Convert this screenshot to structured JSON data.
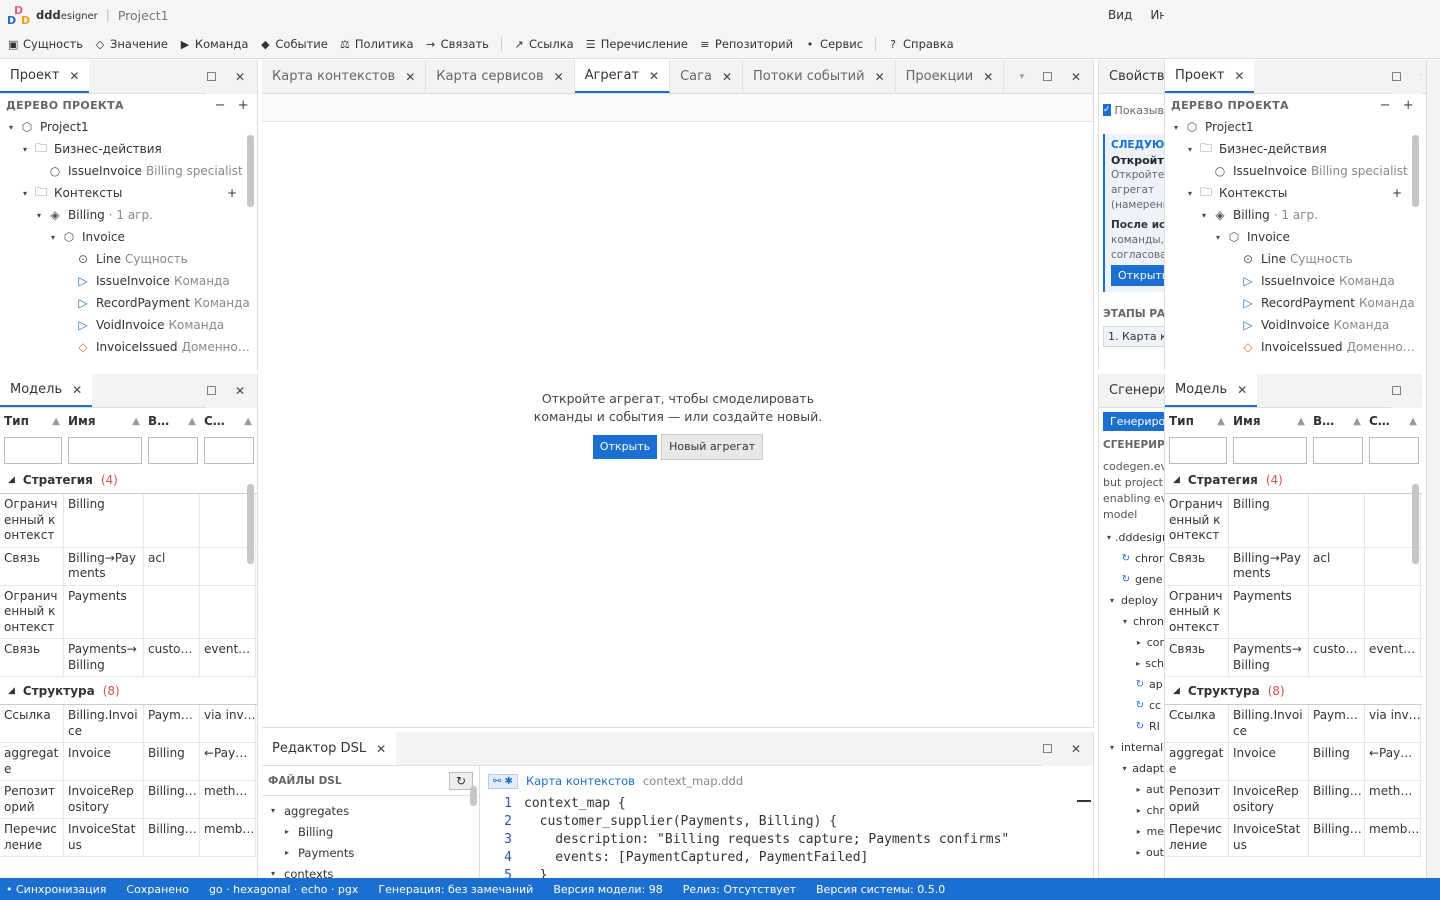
{
  "app": {
    "brand": "ddd",
    "brand_small": "esigner",
    "project": "Project1",
    "menu": [
      "Вид",
      "Инструменты"
    ]
  },
  "toolbar": [
    {
      "icon": "square-icon",
      "glyph": "▣",
      "label": "Сущность"
    },
    {
      "icon": "diamond-icon",
      "glyph": "◇",
      "label": "Значение"
    },
    {
      "icon": "play-icon",
      "glyph": "▶",
      "label": "Команда"
    },
    {
      "icon": "diamond-filled-icon",
      "glyph": "◆",
      "label": "Событие"
    },
    {
      "icon": "scale-icon",
      "glyph": "⚖",
      "label": "Политика"
    },
    {
      "icon": "arrow-right-icon",
      "glyph": "→",
      "label": "Связать"
    },
    {
      "icon": "arrow-up-right-icon",
      "glyph": "↗",
      "label": "Ссылка"
    },
    {
      "icon": "list-icon",
      "glyph": "☰",
      "label": "Перечисление"
    },
    {
      "icon": "db-icon",
      "glyph": "≡",
      "label": "Репозиторий"
    },
    {
      "icon": "dot-icon",
      "glyph": "•",
      "label": "Сервис"
    },
    {
      "icon": "help-icon",
      "glyph": "?",
      "label": "Справка"
    }
  ],
  "project_panel": {
    "tab": "Проект",
    "section": "ДЕРЕВО ПРОЕКТА",
    "tree": [
      {
        "label": "Project1",
        "sub": "",
        "icon": "cube-icon",
        "glyph": "⬡",
        "caret": "▾",
        "indent": 0
      },
      {
        "label": "Бизнес-действия",
        "sub": "",
        "icon": "folder-icon",
        "glyph": "🗀",
        "caret": "▾",
        "indent": 1
      },
      {
        "label": "IssueInvoice",
        "sub": "Billing specialist",
        "icon": "circle-icon",
        "glyph": "○",
        "caret": "",
        "indent": 2
      },
      {
        "label": "Контексты",
        "sub": "",
        "icon": "folder-icon",
        "glyph": "🗀",
        "caret": "▾",
        "indent": 1,
        "plus": "+"
      },
      {
        "label": "Billing",
        "sub": "· 1 агр.",
        "icon": "layers-icon",
        "glyph": "◈",
        "caret": "▾",
        "indent": 2
      },
      {
        "label": "Invoice",
        "sub": "",
        "icon": "cube-icon",
        "glyph": "⬡",
        "caret": "▾",
        "indent": 3
      },
      {
        "label": "Line",
        "sub": "Сущность",
        "icon": "entity-icon",
        "glyph": "⊙",
        "caret": "",
        "indent": 4
      },
      {
        "label": "IssueInvoice",
        "sub": "Команда",
        "icon": "command-icon",
        "glyph": "▷",
        "caret": "",
        "indent": 4
      },
      {
        "label": "RecordPayment",
        "sub": "Команда",
        "icon": "command-icon",
        "glyph": "▷",
        "caret": "",
        "indent": 4
      },
      {
        "label": "VoidInvoice",
        "sub": "Команда",
        "icon": "command-icon",
        "glyph": "▷",
        "caret": "",
        "indent": 4
      },
      {
        "label": "InvoiceIssued",
        "sub": "Доменно…",
        "icon": "event-icon",
        "glyph": "◇",
        "caret": "",
        "indent": 4
      }
    ]
  },
  "model_panel": {
    "tab": "Модель",
    "columns": [
      "Тип",
      "Имя",
      "В…",
      "С…"
    ],
    "groups": [
      {
        "name": "Стратегия",
        "count": "(4)",
        "rows": [
          [
            "Ограниченный контекст",
            "Billing",
            "",
            ""
          ],
          [
            "Связь",
            "Billing→Payments",
            "acl",
            ""
          ],
          [
            "Ограниченный контекст",
            "Payments",
            "",
            ""
          ],
          [
            "Связь",
            "Payments→Billing",
            "custo…",
            "event…"
          ]
        ]
      },
      {
        "name": "Структура",
        "count": "(8)",
        "rows": [
          [
            "Ссылка",
            "Billing.Invoice",
            "Paym…",
            "via inv…"
          ],
          [
            "aggregate",
            "Invoice",
            "Billing",
            "←Pay…"
          ],
          [
            "Репозиторий",
            "InvoiceRepository",
            "Billing…",
            "meth…"
          ],
          [
            "Перечисление",
            "InvoiceStatus",
            "Billing…",
            "memb…"
          ]
        ]
      }
    ]
  },
  "editor": {
    "tabs": [
      "Карта контекстов",
      "Карта сервисов",
      "Агрегат",
      "Сага",
      "Потоки событий",
      "Проекции"
    ],
    "active_tab": "Агрегат",
    "empty_text_1": "Откройте агрегат, чтобы смоделировать",
    "empty_text_2": "команды и события — или создайте новый.",
    "open_btn": "Открыть",
    "new_btn": "Новый агрегат"
  },
  "dsl": {
    "tab": "Редактор DSL",
    "files_label": "ФАЙЛЫ DSL",
    "refresh": "↻",
    "files": [
      {
        "label": "aggregates",
        "caret": "▾",
        "indent": 0
      },
      {
        "label": "Billing",
        "caret": "▸",
        "indent": 1
      },
      {
        "label": "Payments",
        "caret": "▸",
        "indent": 1
      },
      {
        "label": "contexts",
        "caret": "▾",
        "indent": 0
      }
    ],
    "chip": "⚯ ✱",
    "crumb_main": "Карта контекстов",
    "crumb_file": "context_map.ddd",
    "lines": [
      {
        "n": "1",
        "text": "context_map {"
      },
      {
        "n": "2",
        "text": "  customer_supplier(Payments, Billing) {"
      },
      {
        "n": "3",
        "text": "    description: \"Billing requests capture; Payments confirms\""
      },
      {
        "n": "4",
        "text": "    events: [PaymentCaptured, PaymentFailed]"
      },
      {
        "n": "5",
        "text": "  }"
      }
    ]
  },
  "right": {
    "tabs": [
      "Свойства",
      "Проект"
    ],
    "show_label": "Показывать",
    "next_label": "СЛЕДУЮЩИЙ",
    "next_title": "Откройте",
    "next_desc": "Откройте агрегат (намерения) границы.",
    "next_after": "После исп",
    "next_after2": "команды, согласован",
    "open_btn": "Открыть",
    "stages_label": "ЭТАПЫ РА",
    "stage_1": "1. Карта к",
    "gen_tab": "Сгенерир",
    "gen_btn": "Генериров",
    "gen_section": "СГЕНЕРИРО",
    "gen_text": [
      "codegen.eve",
      "but project.e",
      "enabling eve",
      "model"
    ],
    "gen_tree": [
      {
        "label": ".dddesign",
        "caret": "▾",
        "indent": 0
      },
      {
        "label": "chror",
        "caret": "↻",
        "indent": 1
      },
      {
        "label": "gene",
        "caret": "↻",
        "indent": 1
      },
      {
        "label": "deploy",
        "caret": "▾",
        "indent": 0
      },
      {
        "label": "chron",
        "caret": "▾",
        "indent": 1
      },
      {
        "label": "cor",
        "caret": "▸",
        "indent": 2
      },
      {
        "label": "sch",
        "caret": "▸",
        "indent": 2
      },
      {
        "label": "ap",
        "caret": "↻",
        "indent": 2
      },
      {
        "label": "cc",
        "caret": "↻",
        "indent": 2
      },
      {
        "label": "RI",
        "caret": "↻",
        "indent": 2
      },
      {
        "label": "internal",
        "caret": "▾",
        "indent": 0
      },
      {
        "label": "adapt",
        "caret": "▾",
        "indent": 1
      },
      {
        "label": "aut",
        "caret": "▸",
        "indent": 2
      },
      {
        "label": "chr",
        "caret": "▸",
        "indent": 2
      },
      {
        "label": "me",
        "caret": "▸",
        "indent": 2
      },
      {
        "label": "out",
        "caret": "▸",
        "indent": 2
      }
    ]
  },
  "status": [
    "• Синхронизация",
    "Сохранено",
    "go · hexagonal · echo · pgx",
    "Генерация: без замечаний",
    "Версия модели: 98",
    "Релиз: Отсутствует",
    "Версия системы: 0.5.0"
  ],
  "colors": {
    "accent": "#1a6fd0",
    "count": "#d9534f"
  }
}
